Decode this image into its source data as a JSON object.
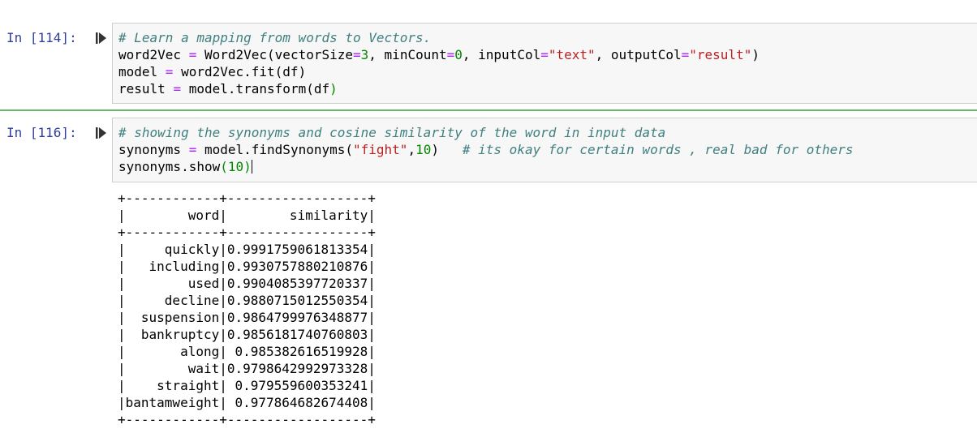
{
  "cells": [
    {
      "prompt": "In [114]:",
      "lines": {
        "l1_comment": "# Learn a mapping from words to Vectors.",
        "l2_a": "word2Vec ",
        "l2_eq": "=",
        "l2_b": " Word2Vec(vectorSize",
        "l2_eq2": "=",
        "l2_n1": "3",
        "l2_c": ", minCount",
        "l2_eq3": "=",
        "l2_n2": "0",
        "l2_d": ", inputCol",
        "l2_eq4": "=",
        "l2_s1": "\"text\"",
        "l2_e": ", outputCol",
        "l2_eq5": "=",
        "l2_s2": "\"result\"",
        "l2_f": ")",
        "l3_a": "model ",
        "l3_eq": "=",
        "l3_b": " word2Vec.fit(df)",
        "l4_a": "result ",
        "l4_eq": "=",
        "l4_b": " model.transform(df",
        "l4_c": ")"
      }
    },
    {
      "prompt": "In [116]:",
      "lines": {
        "l1_comment": "# showing the synonyms and cosine similarity of the word in input data",
        "l2_a": "synonyms ",
        "l2_eq": "=",
        "l2_b": " model.findSynonyms(",
        "l2_s": "\"fight\"",
        "l2_c": ",",
        "l2_n": "10",
        "l2_d": ")   ",
        "l2_comment": "# its okay for certain words , real bad for others",
        "l3_a": "synonyms.show",
        "l3_b": "(",
        "l3_n": "10",
        "l3_c": ")"
      }
    }
  ],
  "output": {
    "border": "+------------+------------------+",
    "header": "|        word|        similarity|",
    "rows": [
      "|     quickly|0.9991759061813354|",
      "|   including|0.9930757880210876|",
      "|        used|0.9904085397720337|",
      "|     decline|0.9880715012550354|",
      "|  suspension|0.9864799976348877|",
      "|  bankruptcy|0.9856181740760803|",
      "|       along| 0.985382616519928|",
      "|        wait|0.9798642992973328|",
      "|    straight| 0.979559600353241|",
      "|bantamweight| 0.977864682674408|"
    ]
  },
  "colors": {
    "prompt": "#303F9F",
    "comment": "#408080",
    "string": "#BA2121",
    "number": "#008800",
    "operator": "#AA22FF",
    "active_cell_border": "#66BB6A"
  },
  "icons": {
    "run": "run-cell-icon"
  }
}
